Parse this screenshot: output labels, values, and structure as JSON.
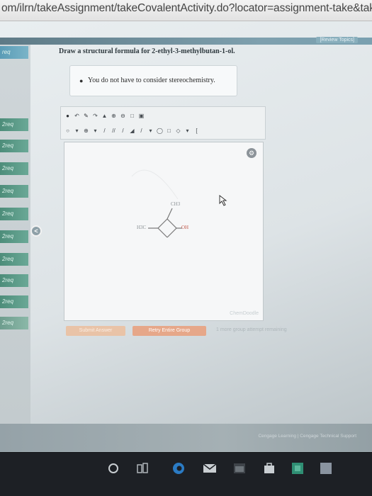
{
  "browser": {
    "url": "om/ilrn/takeAssignment/takeCovalentActivity.do?locator=assignment-take&takeAssignm"
  },
  "header": {
    "review_topics": "[Review Topics]"
  },
  "sidebar": {
    "items": [
      {
        "label": "req"
      },
      {
        "label": "2req"
      },
      {
        "label": "2req"
      },
      {
        "label": "2req"
      },
      {
        "label": "2req"
      },
      {
        "label": "2req"
      },
      {
        "label": "2req"
      },
      {
        "label": "2req"
      },
      {
        "label": "2req"
      },
      {
        "label": "2req"
      },
      {
        "label": "2req"
      }
    ]
  },
  "question": {
    "prompt": "Draw a structural formula for 2-ethyl-3-methylbutan-1-ol.",
    "note": "You do not have to consider stereochemistry."
  },
  "drawing": {
    "h3c": "H3C",
    "oh": "OH",
    "ch3": "CH3",
    "watermark": "ChemDoodle"
  },
  "actions": {
    "submit": "Submit Answer",
    "retry": "Retry Entire Group",
    "attempts": "1 more group attempt remaining"
  },
  "footer": {
    "text": "Cengage Learning | Cengage Technical Support"
  },
  "colors": {
    "nav": "#6f93a2",
    "sidebar_item": "#5b9a86",
    "retry_button": "#e6a789",
    "submit_button": "#e9c3a7"
  }
}
